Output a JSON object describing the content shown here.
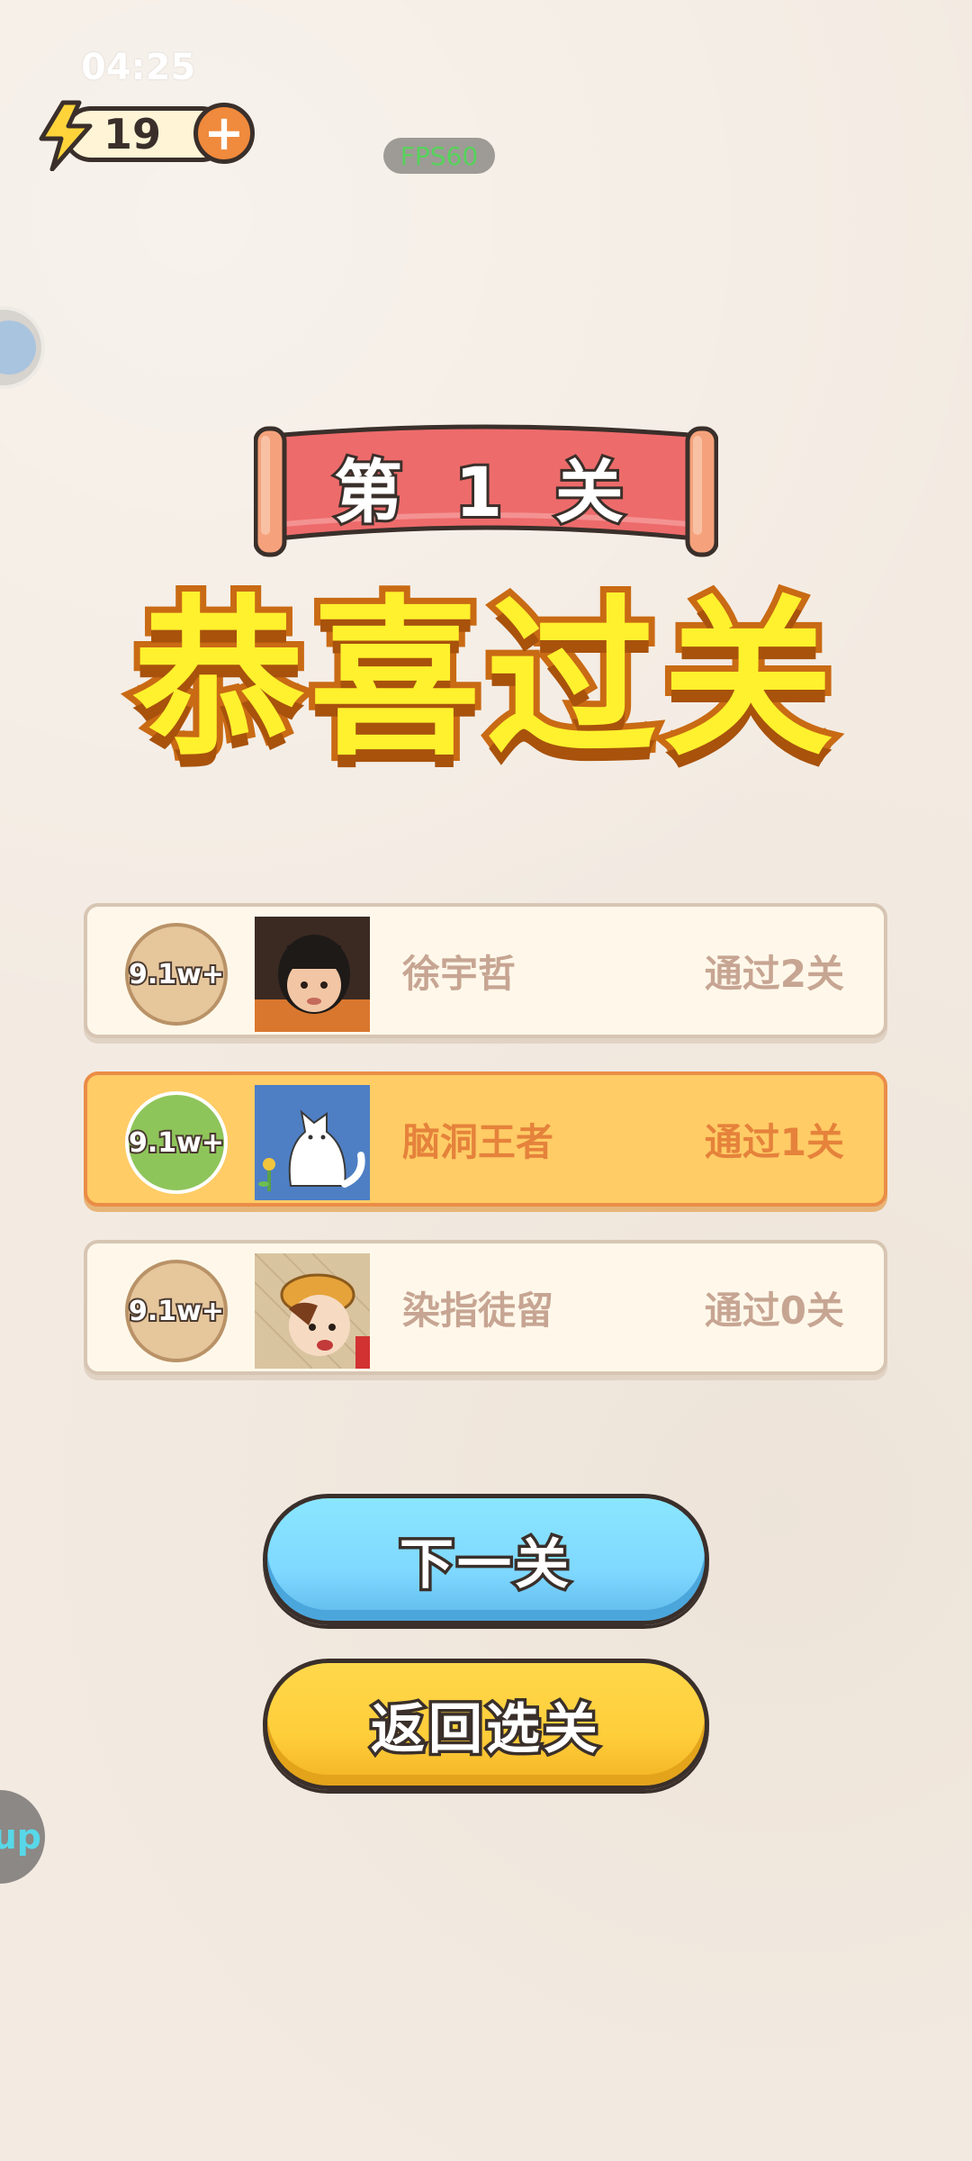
{
  "status_bar": {
    "time": "04:25"
  },
  "energy": {
    "count": "19",
    "plus": "+"
  },
  "fps": "FPS60",
  "help_label": "up",
  "level_banner": "第 1 关",
  "congrats_title": "恭喜过关",
  "ranking": [
    {
      "badge": "9.1w+",
      "name": "徐宇哲",
      "progress": "通过2关",
      "is_me": false
    },
    {
      "badge": "9.1w+",
      "name": "脑洞王者",
      "progress": "通过1关",
      "is_me": true
    },
    {
      "badge": "9.1w+",
      "name": "染指徒留",
      "progress": "通过0关",
      "is_me": false
    }
  ],
  "buttons": {
    "next": "下一关",
    "back": "返回选关"
  },
  "colors": {
    "background": "#f3ebe2",
    "banner_red": "#ee6b6b",
    "title_yellow": "#fff12e",
    "highlight_row": "#ffcc66",
    "next_button": "#7fd8ff",
    "back_button": "#ffcd3a"
  }
}
